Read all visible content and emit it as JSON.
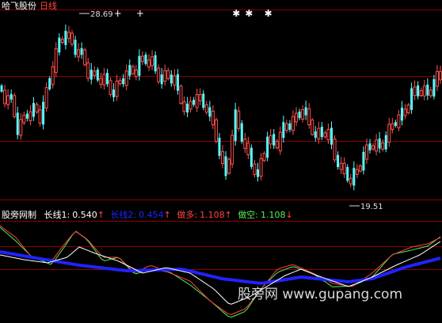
{
  "window": {
    "stock_name": "哈飞股份",
    "period": "日线"
  },
  "price_panel": {
    "high_label": "28.69",
    "low_label": "19.51",
    "markers": [
      {
        "symbol": "+",
        "bar": 36
      },
      {
        "symbol": "+",
        "bar": 43
      },
      {
        "symbol": "✱",
        "bar": 73
      },
      {
        "symbol": "✱",
        "bar": 77
      },
      {
        "symbol": "✱",
        "bar": 83
      }
    ]
  },
  "indicator": {
    "name": "股旁网制",
    "lines": [
      {
        "label": "长线1:",
        "value": "0.540",
        "arrow": "↑",
        "color": "#ffffff"
      },
      {
        "label": "长线2:",
        "value": "0.454",
        "arrow": "↑",
        "color": "#2222ff"
      },
      {
        "label": "做多:",
        "value": "1.108",
        "arrow": "↑",
        "color": "#ff4444"
      },
      {
        "label": "做空:",
        "value": "1.108",
        "arrow": "↓",
        "color": "#55ee55"
      }
    ]
  },
  "watermark": "股旁网 www.gupang.com",
  "colors": {
    "up_candle": "#ff5050",
    "down_candle": "#54ffff",
    "grid": "#8a0000",
    "long1": "#ffffff",
    "long2": "#2222ff",
    "bull": "#ff4444",
    "bear": "#55ee55"
  }
}
